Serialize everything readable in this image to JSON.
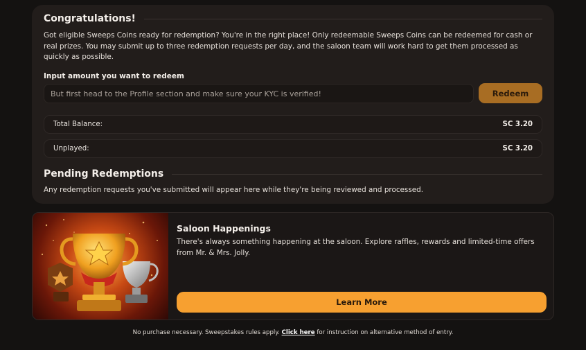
{
  "redeem": {
    "title": "Congratulations!",
    "intro": "Got eligible Sweeps Coins ready for redemption? You're in the right place! Only redeemable Sweeps Coins can be redeemed for cash or real prizes. You may submit up to three redemption requests per day, and the saloon team will work hard to get them processed as quickly as possible.",
    "input_label": "Input amount you want to redeem",
    "input_placeholder": "But first head to the Profile section and make sure your KYC is verified!",
    "redeem_button": "Redeem",
    "balances": [
      {
        "label": "Total Balance:",
        "value": "SC 3.20"
      },
      {
        "label": "Unplayed:",
        "value": "SC 3.20"
      }
    ],
    "pending_title": "Pending Redemptions",
    "pending_text": "Any redemption requests you've submitted will appear here while they're being reviewed and processed."
  },
  "promo": {
    "title": "Saloon Happenings",
    "description": "There's always something happening at the saloon. Explore raffles, rewards and limited-time offers from Mr. & Mrs. Jolly.",
    "button": "Learn More",
    "image_icon": "trophy-icon"
  },
  "footer": {
    "prefix": "No purchase necessary. Sweepstakes rules apply.",
    "link": "Click here",
    "suffix": "for instruction on alternative method of entry."
  },
  "colors": {
    "accent": "#f7a030",
    "accent_dim": "#a86d23",
    "panel": "#221d1b",
    "background": "#141211"
  }
}
